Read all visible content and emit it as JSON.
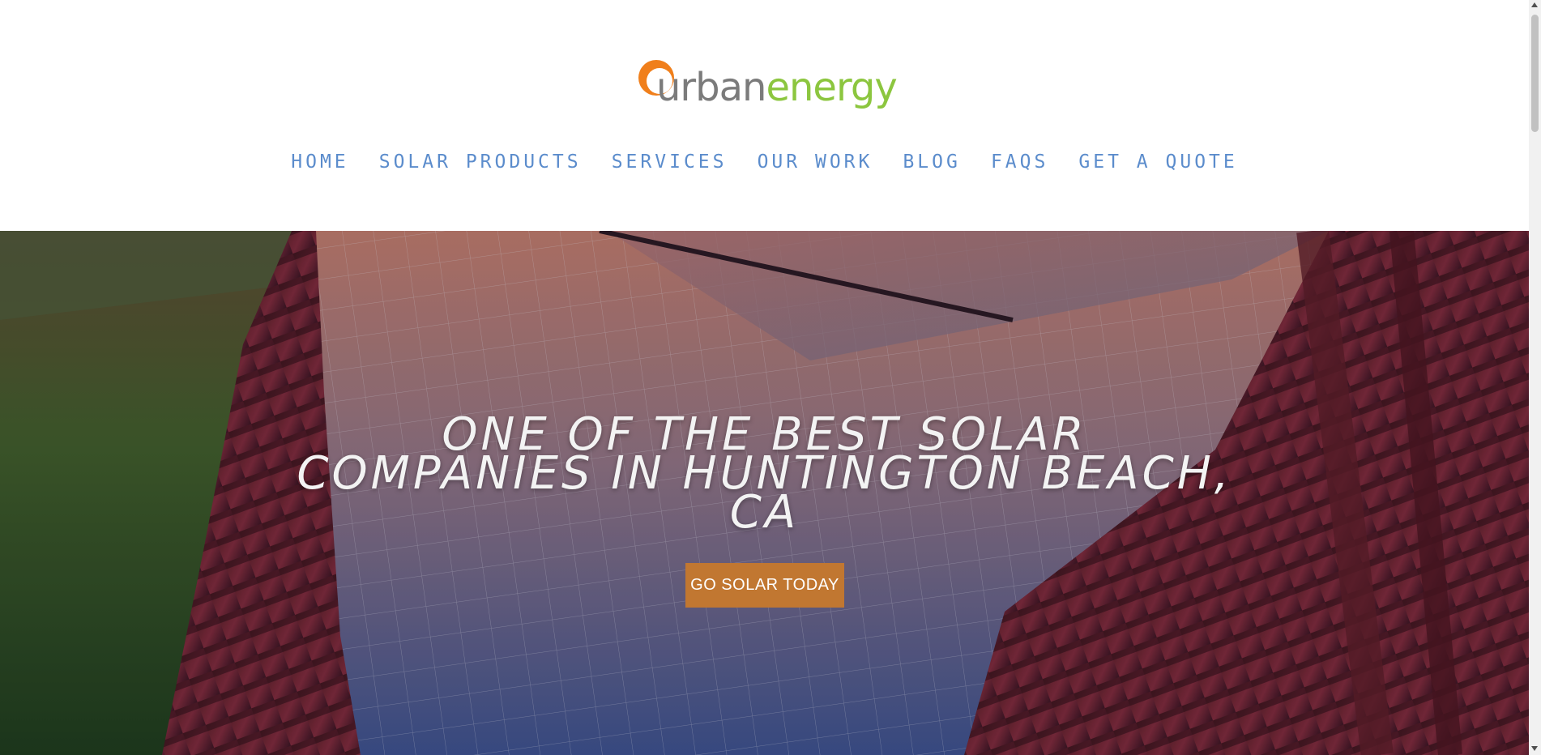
{
  "logo": {
    "part1": "urban",
    "part2": "energy",
    "icon": "sun-icon"
  },
  "nav": {
    "items": [
      {
        "label": "HOME"
      },
      {
        "label": "SOLAR PRODUCTS"
      },
      {
        "label": "SERVICES"
      },
      {
        "label": "OUR WORK"
      },
      {
        "label": "BLOG"
      },
      {
        "label": "FAQS"
      },
      {
        "label": "GET A QUOTE"
      }
    ]
  },
  "hero": {
    "title": "ONE OF THE BEST SOLAR COMPANIES IN HUNTINGTON BEACH, CA",
    "cta_label": "GO SOLAR TODAY"
  },
  "colors": {
    "nav_text": "#5b8ccc",
    "cta_bg": "#c17731",
    "logo_gray": "#7b7b7b",
    "logo_green": "#8cc63f",
    "logo_orange": "#f07f1b"
  }
}
